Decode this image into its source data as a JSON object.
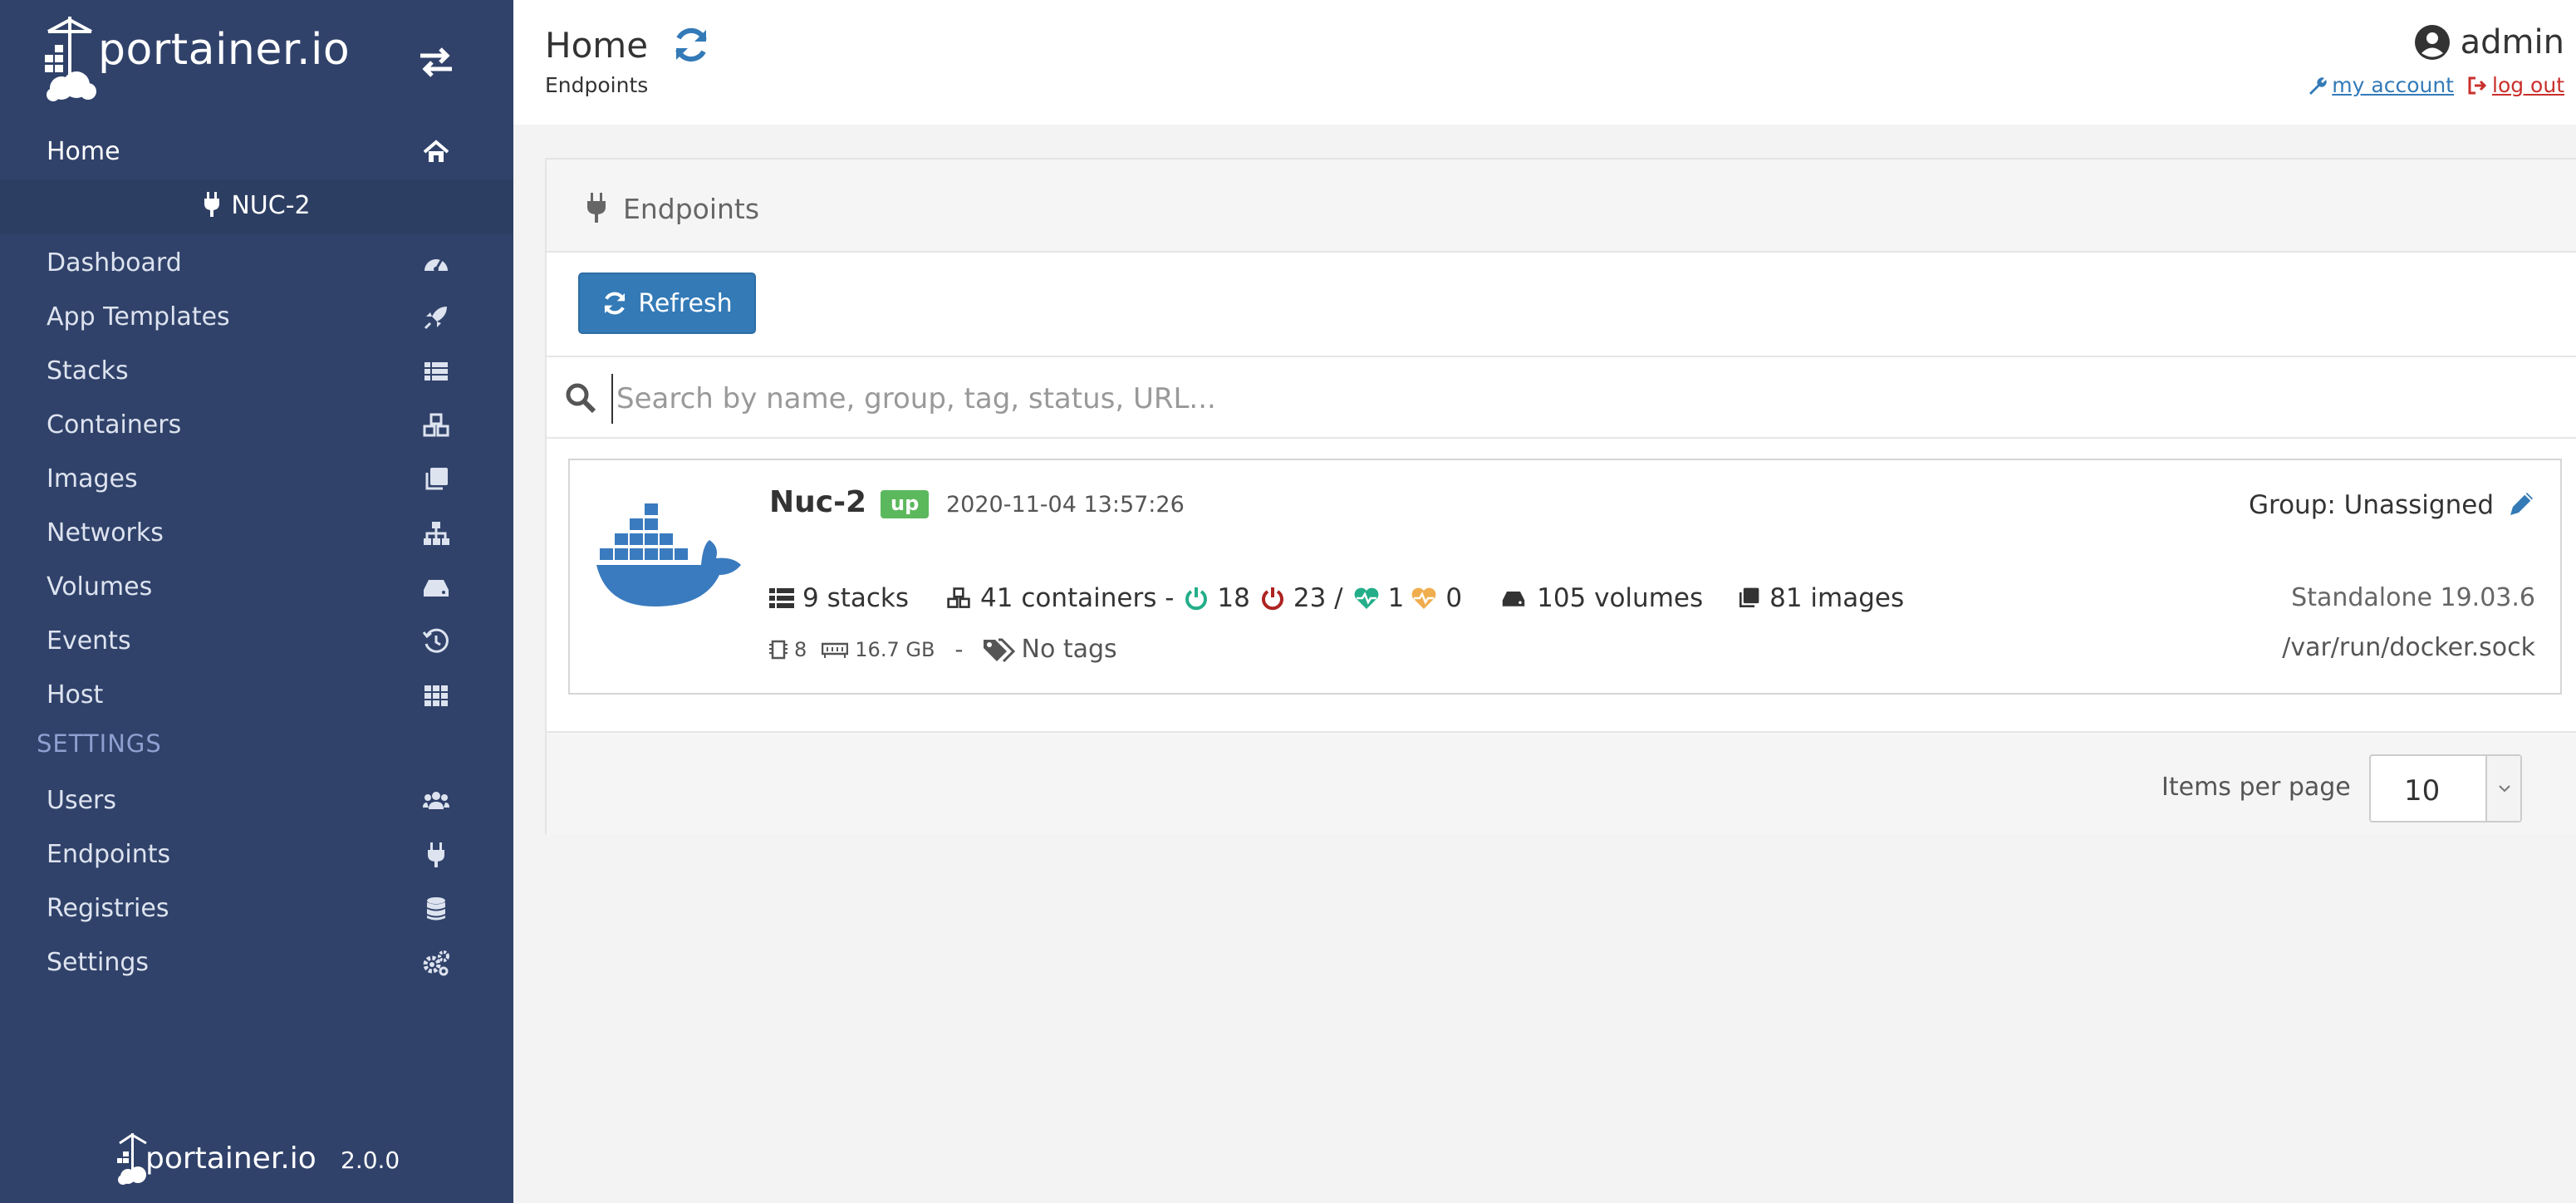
{
  "brand": {
    "logo_text": "portainer.io",
    "version": "2.0.0",
    "footer_logo_text": "portainer.io"
  },
  "sidebar": {
    "home_label": "Home",
    "environment": "NUC-2",
    "items": [
      {
        "label": "Dashboard",
        "icon": "dashboard-icon"
      },
      {
        "label": "App Templates",
        "icon": "rocket-icon"
      },
      {
        "label": "Stacks",
        "icon": "list-icon"
      },
      {
        "label": "Containers",
        "icon": "cubes-icon"
      },
      {
        "label": "Images",
        "icon": "clone-icon"
      },
      {
        "label": "Networks",
        "icon": "sitemap-icon"
      },
      {
        "label": "Volumes",
        "icon": "hdd-icon"
      },
      {
        "label": "Events",
        "icon": "history-icon"
      },
      {
        "label": "Host",
        "icon": "grid-icon"
      }
    ],
    "settings_title": "SETTINGS",
    "settings_items": [
      {
        "label": "Users",
        "icon": "users-icon"
      },
      {
        "label": "Endpoints",
        "icon": "plug-icon"
      },
      {
        "label": "Registries",
        "icon": "database-icon"
      },
      {
        "label": "Settings",
        "icon": "cogs-icon"
      }
    ]
  },
  "header": {
    "title": "Home",
    "breadcrumb": "Endpoints",
    "username": "admin",
    "my_account": "my account",
    "log_out": "log out"
  },
  "panel": {
    "title": "Endpoints",
    "refresh_label": "Refresh",
    "search_placeholder": "Search by name, group, tag, status, URL..."
  },
  "endpoint": {
    "name": "Nuc-2",
    "status": "up",
    "timestamp": "2020-11-04 13:57:26",
    "group": "Group: Unassigned",
    "stacks": "9 stacks",
    "containers": "41 containers -",
    "running": "18",
    "stopped": "23 /",
    "healthy": "1",
    "unhealthy": "0",
    "volumes": "105 volumes",
    "images": "81 images",
    "cpu": "8",
    "memory": "16.7 GB",
    "separator": "-",
    "tags": "No tags",
    "type": "Standalone 19.03.6",
    "url": "/var/run/docker.sock"
  },
  "pagination": {
    "label": "Items per page",
    "value": "10"
  },
  "colors": {
    "sidebar": "#30426a",
    "primary": "#337ab7",
    "up": "#5cb85c",
    "running": "#23ae89",
    "stopped": "#ae2323",
    "healthy": "#23ae89",
    "unhealthy": "#f0ad4e"
  }
}
